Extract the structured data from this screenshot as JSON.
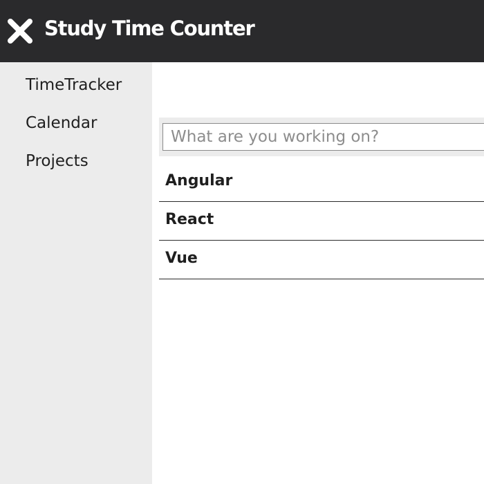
{
  "header": {
    "title": "Study Time Counter",
    "close_icon": "close-icon"
  },
  "sidebar": {
    "items": [
      {
        "label": "TimeTracker"
      },
      {
        "label": "Calendar"
      },
      {
        "label": "Projects"
      }
    ]
  },
  "main": {
    "search": {
      "placeholder": "What are you working on?",
      "value": ""
    },
    "projects": [
      {
        "label": "Angular"
      },
      {
        "label": "React"
      },
      {
        "label": "Vue"
      }
    ]
  },
  "colors": {
    "header_bg": "#2a2a2c",
    "sidebar_bg": "#ececec",
    "text": "#1f1f1f"
  }
}
